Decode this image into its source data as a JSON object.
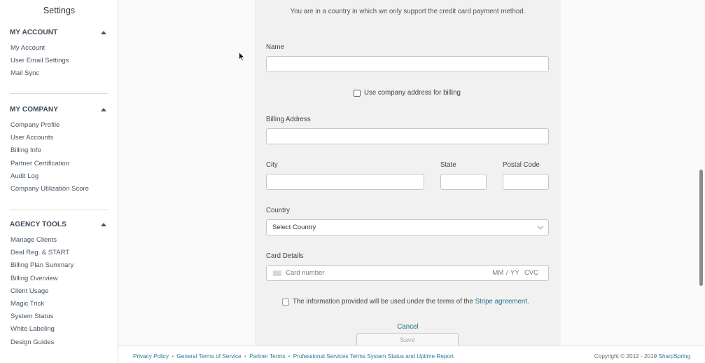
{
  "sidebar": {
    "title": "Settings",
    "sections": [
      {
        "heading": "MY ACCOUNT",
        "items": [
          "My Account",
          "User Email Settings",
          "Mail Sync"
        ]
      },
      {
        "heading": "MY COMPANY",
        "items": [
          "Company Profile",
          "User Accounts",
          "Billing Info",
          "Partner Certification",
          "Audit Log",
          "Company Utilization Score"
        ]
      },
      {
        "heading": "AGENCY TOOLS",
        "items": [
          "Manage Clients",
          "Deal Reg. & START",
          "Billing Plan Summary",
          "Billing Overview",
          "Client Usage",
          "Magic Trick",
          "System Status",
          "White Labeling",
          "Design Guides"
        ]
      }
    ]
  },
  "form": {
    "notice": "You are in a country in which we only support the credit card payment method.",
    "name_label": "Name",
    "name_value": "",
    "use_company_address_label": "Use company address for billing",
    "billing_address_label": "Billing Address",
    "billing_address_value": "",
    "city_label": "City",
    "state_label": "State",
    "postal_code_label": "Postal Code",
    "country_label": "Country",
    "country_selected": "Select Country",
    "card_details_label": "Card Details",
    "card_number_placeholder": "Card number",
    "card_expiry_placeholder": "MM / YY",
    "card_cvc_placeholder": "CVC",
    "terms_prefix": "The information provided will be used under the terms of the",
    "terms_link": "Stripe agreement",
    "terms_suffix": ".",
    "cancel_label": "Cancel",
    "save_label": "Save"
  },
  "footer": {
    "links": [
      "Privacy Policy",
      "General Terms of Service",
      "Partner Terms",
      "Professional Services Terms",
      "System Status and Uptime Report"
    ],
    "separator": "•",
    "copyright_prefix": "Copyright © 2012 - 2019",
    "brand": "SharpSpring"
  },
  "colors": {
    "link": "#1f6f8b",
    "panel_background": "#f1f1f1"
  }
}
